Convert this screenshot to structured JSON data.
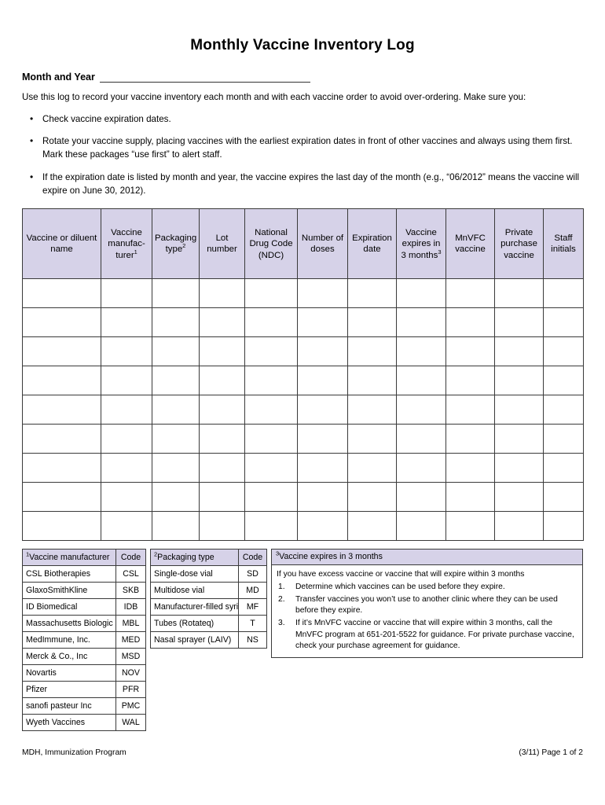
{
  "document": {
    "title": "Monthly Vaccine Inventory Log",
    "month_year_label": "Month and Year",
    "month_year_value": "",
    "intro": "Use this log to record your vaccine inventory each month and with each vaccine order to avoid over-ordering. Make sure you:",
    "bullets": [
      "Check vaccine expiration dates.",
      "Rotate your vaccine supply, placing vaccines with the earliest expiration dates in front of other vaccines and always using them first. Mark these packages “use first” to alert staff.",
      "If the expiration date is listed by month and year, the vaccine expires the last day of the month (e.g., “06/2012” means the vaccine will expire on June 30, 2012)."
    ]
  },
  "inventory_table": {
    "columns": [
      {
        "label": "Vaccine or diluent name",
        "sup": ""
      },
      {
        "label": "Vaccine manufac-turer",
        "sup": "1"
      },
      {
        "label": "Packaging type",
        "sup": "2"
      },
      {
        "label": "Lot number",
        "sup": ""
      },
      {
        "label": "National Drug Code (NDC)",
        "sup": ""
      },
      {
        "label": "Number of doses",
        "sup": ""
      },
      {
        "label": "Expiration date",
        "sup": ""
      },
      {
        "label": "Vaccine expires in 3 months",
        "sup": "3"
      },
      {
        "label": "MnVFC vaccine",
        "sup": ""
      },
      {
        "label": "Private purchase vaccine",
        "sup": ""
      },
      {
        "label": "Staff initials",
        "sup": ""
      }
    ],
    "empty_row_count": 9
  },
  "manufacturer_table": {
    "header_marker": "1",
    "header_name": "Vaccine manufacturer",
    "header_code": "Code",
    "rows": [
      {
        "name": "CSL Biotherapies",
        "code": "CSL"
      },
      {
        "name": "GlaxoSmithKline",
        "code": "SKB"
      },
      {
        "name": "ID Biomedical",
        "code": "IDB"
      },
      {
        "name": "Massachusetts Biologic Labs",
        "code": "MBL"
      },
      {
        "name": "MedImmune, Inc.",
        "code": "MED"
      },
      {
        "name": "Merck & Co., Inc",
        "code": "MSD"
      },
      {
        "name": "Novartis",
        "code": "NOV"
      },
      {
        "name": "Pfizer",
        "code": "PFR"
      },
      {
        "name": "sanofi pasteur Inc",
        "code": "PMC"
      },
      {
        "name": "Wyeth Vaccines",
        "code": "WAL"
      }
    ]
  },
  "packaging_table": {
    "header_marker": "2",
    "header_name": "Packaging type",
    "header_code": "Code",
    "rows": [
      {
        "name": "Single-dose vial",
        "code": "SD"
      },
      {
        "name": "Multidose vial",
        "code": "MD"
      },
      {
        "name": "Manufacturer-filled syringe",
        "code": "MF"
      },
      {
        "name": "Tubes (Rotateq)",
        "code": "T"
      },
      {
        "name": "Nasal sprayer (LAIV)",
        "code": "NS"
      }
    ]
  },
  "expire_box": {
    "header_marker": "3",
    "header_title": "Vaccine expires in 3 months",
    "lead": "If you have excess vaccine or vaccine that will expire within 3 months",
    "items": [
      "Determine which vaccines can be used before they expire.",
      "Transfer vaccines you won’t use to another clinic where they can be used before they expire.",
      "If it’s MnVFC vaccine or vaccine that will expire within 3 months, call the MnVFC program at 651-201-5522 for guidance. For private purchase vaccine, check your purchase agreement for guidance."
    ]
  },
  "footer": {
    "left": "MDH, Immunization Program",
    "right": "(3/11) Page 1 of 2"
  },
  "colors": {
    "header_fill": "#d6d2e8",
    "border": "#3a3a3a",
    "text": "#000000"
  }
}
